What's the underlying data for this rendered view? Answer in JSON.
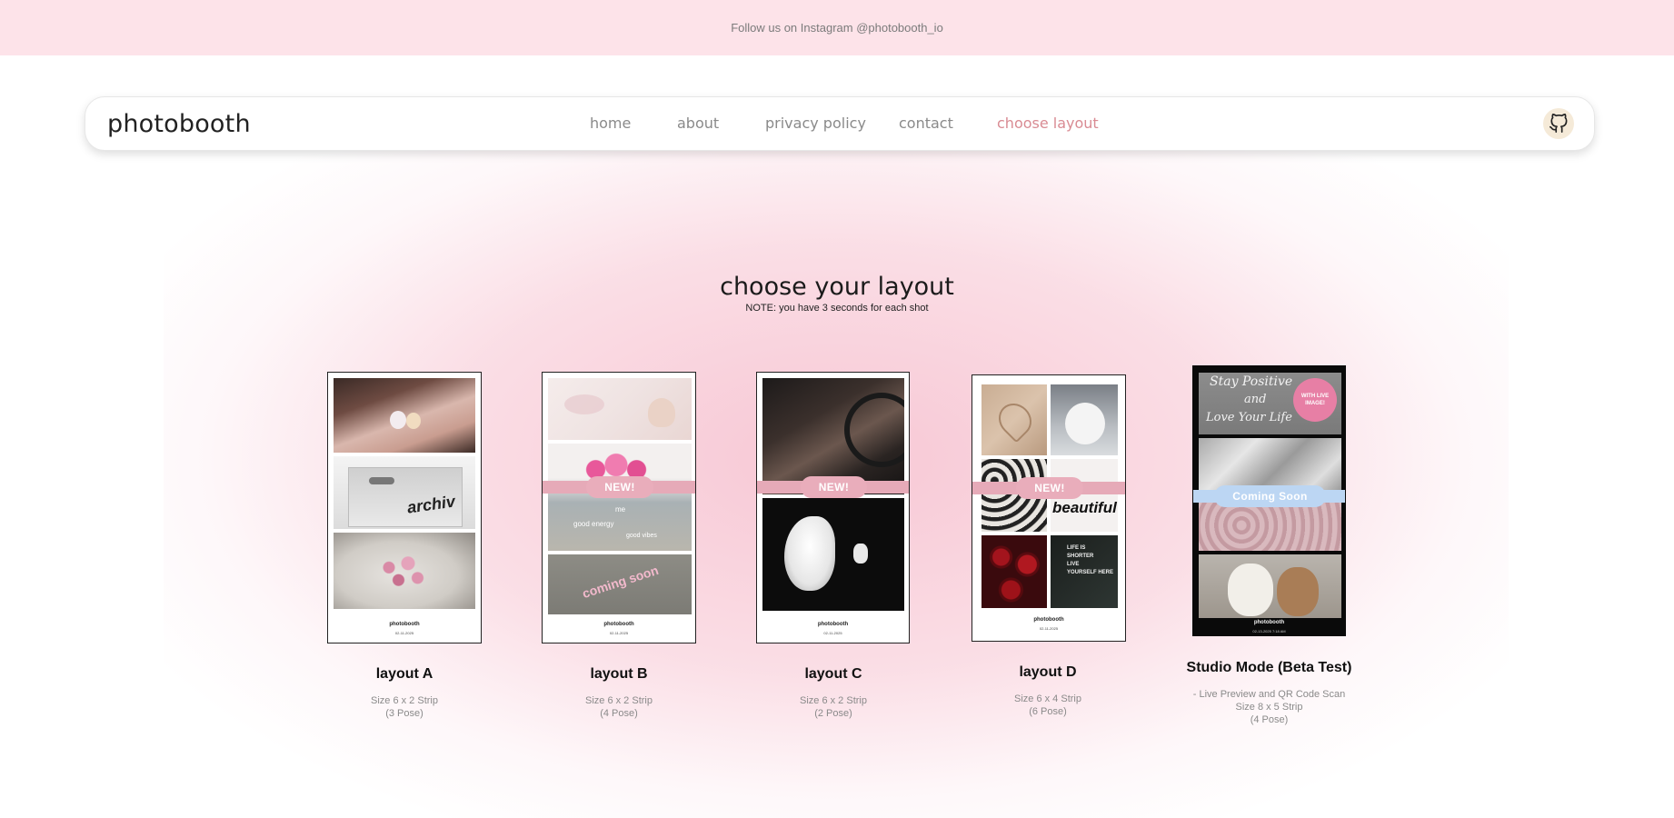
{
  "promo": {
    "text": "Follow us on Instagram @photobooth_io"
  },
  "nav": {
    "brand": "photobooth",
    "links": [
      "home",
      "about",
      "privacy policy",
      "contact",
      "choose layout"
    ],
    "active_link": "choose layout"
  },
  "main": {
    "title": "choose your layout",
    "note": "NOTE: you have 3 seconds for each shot"
  },
  "strip_text": {
    "brand": "photobooth",
    "new_badge": "NEW!",
    "coming_soon_badge": "Coming Soon"
  },
  "photo_text": {
    "archiv": "archiv",
    "me": "me",
    "good_energy": "good energy",
    "good_vibes": "good vibes",
    "coming_soon": "coming soon",
    "stay_positive": "Stay Positive",
    "and": "and",
    "love_your_life": "Love Your Life",
    "with_live_image": "WITH LIVE IMAGE!",
    "life_is": "LIFE IS",
    "life_is_lines": [
      "LIFE IS",
      "SHORTER",
      "LIVE",
      "YOURSELF HERE"
    ],
    "and_beautiful": "and beautiful"
  },
  "layouts": [
    {
      "title": "layout A",
      "lines": [
        "Size 6 x 2 Strip",
        "(3 Pose)"
      ],
      "date": "02-11-2025"
    },
    {
      "title": "layout B",
      "lines": [
        "Size 6 x 2 Strip",
        "(4 Pose)"
      ],
      "date": "02-11-2025"
    },
    {
      "title": "layout C",
      "lines": [
        "Size 6 x 2 Strip",
        "(2 Pose)"
      ],
      "date": "02-11-2025"
    },
    {
      "title": "layout D",
      "lines": [
        "Size 6 x 4 Strip",
        "(6 Pose)"
      ],
      "date": "02-11-2025"
    },
    {
      "title": "Studio Mode (Beta Test)",
      "lines": [
        "- Live Preview and QR Code Scan",
        "Size 8 x 5 Strip",
        "(4 Pose)"
      ],
      "date": "02-13-2025 7:18 AM"
    }
  ],
  "colors": {
    "promo_bg": "#fde3e9",
    "accent": "#d98b93",
    "badge_pink": "#e9adbb",
    "badge_blue": "#bcd6f3"
  },
  "icons": {
    "github": "github-icon"
  }
}
